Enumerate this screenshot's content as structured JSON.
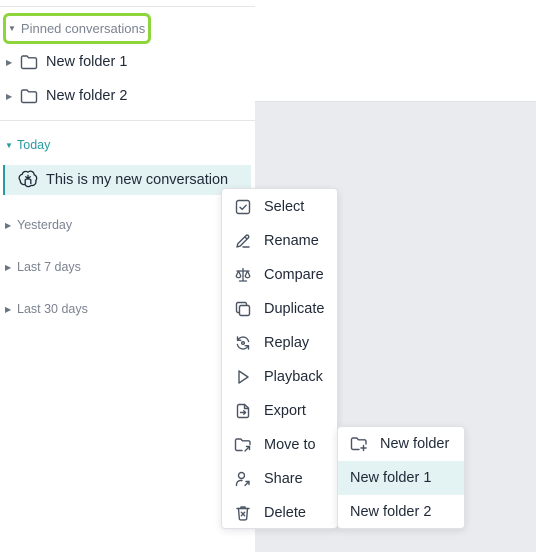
{
  "sidebar": {
    "pinned_label": "Pinned conversations",
    "folders": [
      {
        "label": "New folder 1",
        "icon": "folder-icon"
      },
      {
        "label": "New folder 2",
        "icon": "folder-icon"
      }
    ],
    "sections": {
      "today": "Today",
      "yesterday": "Yesterday",
      "last7": "Last 7 days",
      "last30": "Last 30 days"
    },
    "conversation": {
      "label": "This is my new conversation",
      "icon": "openai-icon"
    }
  },
  "context_menu": {
    "items": [
      {
        "label": "Select",
        "icon": "checkbox-icon"
      },
      {
        "label": "Rename",
        "icon": "pencil-icon"
      },
      {
        "label": "Compare",
        "icon": "scale-icon"
      },
      {
        "label": "Duplicate",
        "icon": "copy-icon"
      },
      {
        "label": "Replay",
        "icon": "replay-icon"
      },
      {
        "label": "Playback",
        "icon": "play-icon"
      },
      {
        "label": "Export",
        "icon": "export-icon"
      },
      {
        "label": "Move to",
        "icon": "folder-move-icon"
      },
      {
        "label": "Share",
        "icon": "share-user-icon"
      },
      {
        "label": "Delete",
        "icon": "trash-icon"
      }
    ]
  },
  "submenu": {
    "items": [
      {
        "label": "New folder",
        "icon": "folder-plus-icon"
      },
      {
        "label": "New folder 1",
        "highlighted": true
      },
      {
        "label": "New folder 2"
      }
    ]
  },
  "colors": {
    "accent": "#2a9aa0",
    "highlight_bg": "#e3f2f3",
    "pinned_border": "#8ed43b",
    "main_bg": "#e9ebef"
  }
}
